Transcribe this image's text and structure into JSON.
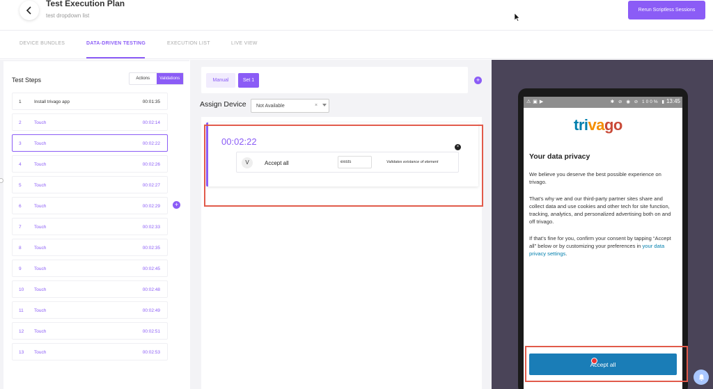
{
  "header": {
    "title": "Test Execution Plan",
    "subtitle": "test dropdown list",
    "rerun_label": "Rerun Scriptless Sessions"
  },
  "tabs": [
    {
      "label": "DEVICE BUNDLES",
      "active": false
    },
    {
      "label": "DATA-DRIVEN TESTING",
      "active": true
    },
    {
      "label": "EXECUTION LIST",
      "active": false
    },
    {
      "label": "LIVE VIEW",
      "active": false
    }
  ],
  "steps_panel": {
    "title": "Test Steps",
    "toggle": {
      "actions": "Actions",
      "validations": "Validations"
    },
    "add_label": "+",
    "steps": [
      {
        "num": "1",
        "name": "Install trivago app",
        "time": "00:01:35"
      },
      {
        "num": "2",
        "name": "Touch",
        "time": "00:02:14"
      },
      {
        "num": "3",
        "name": "Touch",
        "time": "00:02:22"
      },
      {
        "num": "4",
        "name": "Touch",
        "time": "00:02:26"
      },
      {
        "num": "5",
        "name": "Touch",
        "time": "00:02:27"
      },
      {
        "num": "6",
        "name": "Touch",
        "time": "00:02:29"
      },
      {
        "num": "7",
        "name": "Touch",
        "time": "00:02:33"
      },
      {
        "num": "8",
        "name": "Touch",
        "time": "00:02:35"
      },
      {
        "num": "9",
        "name": "Touch",
        "time": "00:02:45"
      },
      {
        "num": "10",
        "name": "Touch",
        "time": "00:02:48"
      },
      {
        "num": "11",
        "name": "Touch",
        "time": "00:02:49"
      },
      {
        "num": "12",
        "name": "Touch",
        "time": "00:02:51"
      },
      {
        "num": "13",
        "name": "Touch",
        "time": "00:02:53"
      }
    ]
  },
  "sets": {
    "manual": "Manual",
    "set1": "Set 1",
    "add_label": "+"
  },
  "assign": {
    "label": "Assign Device",
    "value": "Not Available",
    "clear": "×"
  },
  "validation": {
    "time": "00:02:22",
    "avatar": "V",
    "action": "Accept all",
    "condition": "exists",
    "description": "Validates existance of element",
    "close": "×"
  },
  "device": {
    "status_clock": "13:45",
    "status_battery": "100%",
    "logo": {
      "p1": "tri",
      "p2": "va",
      "p3": "go"
    },
    "privacy_title": "Your data privacy",
    "para1": "We believe you deserve the best possible experience on trivago.",
    "para2": "That’s why we and our third-party partner sites share and collect data and use cookies and other tech for site function, tracking, analytics, and personalized advertising both on and off trivago.",
    "para3_pre": "If that’s fine for you, confirm your consent by tapping “Accept all” below or by customizing your preferences in ",
    "para3_link": "your data privacy settings",
    "para3_post": ".",
    "accept_label": "Accept all"
  },
  "colors": {
    "accent": "#8b5cf6",
    "highlight": "#e15a4a",
    "device_bg": "#4a4458",
    "accept_button": "#1a7db7"
  }
}
